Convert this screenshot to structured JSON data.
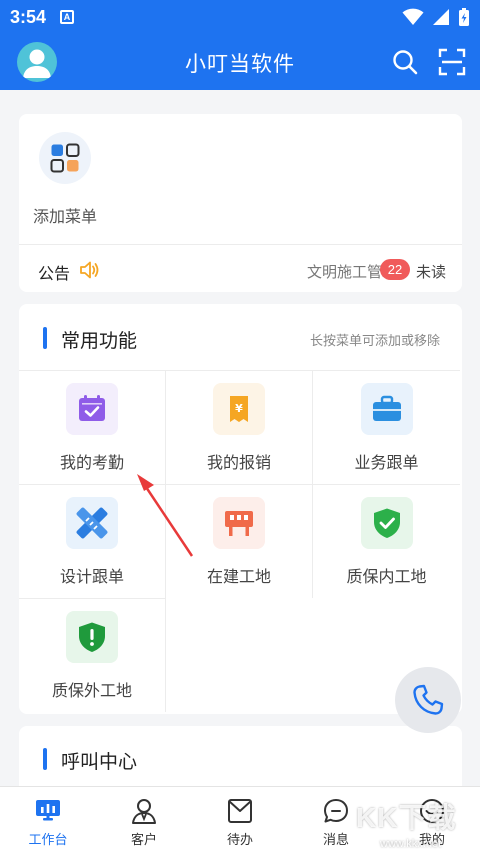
{
  "status_bar": {
    "time": "3:54",
    "notification_letter": "A"
  },
  "app_bar": {
    "title": "小叮当软件"
  },
  "quick_menu": {
    "add_menu_label": "添加菜单"
  },
  "notice": {
    "label": "公告",
    "text": "文明施工管理",
    "unread_count": "22",
    "unread_label": "未读"
  },
  "functions": {
    "title": "常用功能",
    "hint": "长按菜单可添加或移除",
    "items": [
      {
        "label": "我的考勤",
        "icon": "attendance-calendar-icon",
        "bg": "#f3eefc",
        "color": "#8f5ce8"
      },
      {
        "label": "我的报销",
        "icon": "reimbursement-receipt-icon",
        "bg": "#fdf4e6",
        "color": "#f5a623"
      },
      {
        "label": "业务跟单",
        "icon": "business-briefcase-icon",
        "bg": "#e8f2fc",
        "color": "#2b8fe0"
      },
      {
        "label": "设计跟单",
        "icon": "design-ruler-icon",
        "bg": "#e8f2fc",
        "color": "#2b7de0"
      },
      {
        "label": "在建工地",
        "icon": "construction-site-icon",
        "bg": "#fdeeea",
        "color": "#f06a4a"
      },
      {
        "label": "质保内工地",
        "icon": "warranty-shield-check-icon",
        "bg": "#e7f6ea",
        "color": "#2cb04a"
      },
      {
        "label": "质保外工地",
        "icon": "warranty-shield-alert-icon",
        "bg": "#e7f6ea",
        "color": "#1f9a3c"
      }
    ]
  },
  "call_center": {
    "title": "呼叫中心"
  },
  "bottom_nav": {
    "items": [
      {
        "label": "工作台",
        "active": true
      },
      {
        "label": "客户"
      },
      {
        "label": "待办"
      },
      {
        "label": "消息"
      },
      {
        "label": "我的"
      }
    ]
  },
  "watermark": {
    "text": "KK下载",
    "sub": "www.kkx.net"
  },
  "colors": {
    "primary": "#1e73f0",
    "badge": "#f05a5a",
    "arrow": "#e83a3a"
  }
}
